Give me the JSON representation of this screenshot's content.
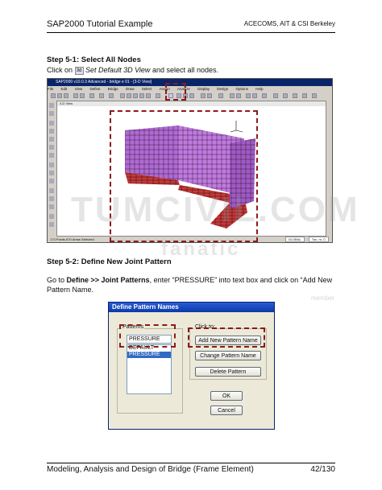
{
  "header": {
    "left": "SAP2000 Tutorial Example",
    "right": "ACECOMS, AIT & CSI Berkeley"
  },
  "step1": {
    "title": "Step 5-1: Select All Nodes",
    "text_pre": "Click on",
    "icon_label": "3d",
    "text_italic": "Set Default 3D View",
    "text_post": "and select all nodes."
  },
  "sap": {
    "title": "SAP2000 v10.0.3 Advanced - bridge e 01 - [3-D View]",
    "menu": [
      "File",
      "Edit",
      "View",
      "Define",
      "Bridge",
      "Draw",
      "Select",
      "Assign",
      "Analyze",
      "Display",
      "Design",
      "Options",
      "Help"
    ],
    "view_title": "3-D View",
    "status_left": "173 Points 870 Areas Selected",
    "status_global": "GLOBAL",
    "status_units": "Ton, m, C"
  },
  "step2": {
    "title": "Step 5-2: Define New Joint Pattern",
    "t1": "Go to",
    "bold1": "Define >> Joint Patterns",
    "t2": ", enter “PRESSURE” into text box and click on “Add New Pattern Name."
  },
  "dialog": {
    "title": "Define Pattern Names",
    "patterns_label": "Patterns",
    "input_value": "PRESSURE",
    "list": [
      "DEFAULT",
      "PRESSURE"
    ],
    "clickto_label": "Click to:",
    "add_btn": "Add New Pattern Name",
    "change_btn": "Change Pattern Name",
    "delete_btn": "Delete Pattern",
    "ok_btn": "OK",
    "cancel_btn": "Cancel"
  },
  "watermark": {
    "line1": "TUMCIVIL.COM",
    "line2": "fanatic",
    "line3": "member"
  },
  "footer": {
    "left": "Modeling, Analysis and Design of Bridge (Frame Element)",
    "right": "42/130"
  }
}
